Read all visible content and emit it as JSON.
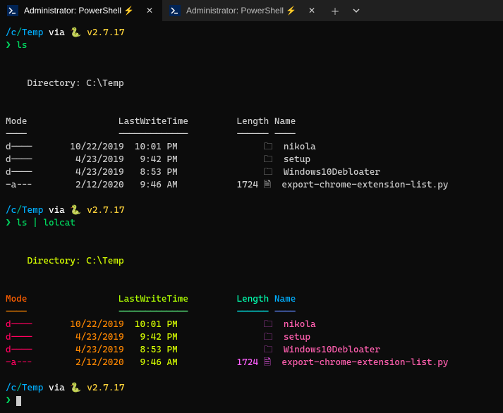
{
  "tabs": [
    {
      "title": "Administrator: PowerShell ⚡"
    },
    {
      "title": "Administrator: PowerShell ⚡"
    }
  ],
  "prompt": {
    "path_pre": "/c",
    "path_sep": "/",
    "path_post": "Temp",
    "via": " via ",
    "python_icon": "🐍",
    "python_ver": " v2.7.17",
    "arrow": "❯ "
  },
  "cmds": {
    "ls": "ls",
    "pipe": " | ",
    "lolcat": "lolcat"
  },
  "listing": {
    "dir_label": "    Directory: C:\\Temp",
    "hdr_mode": "Mode",
    "hdr_lwt": "LastWriteTime",
    "hdr_len": "Length",
    "hdr_name": "Name",
    "dash_mode": "----",
    "dash_lwt": "-------------",
    "dash_len": "------",
    "dash_name": "----",
    "rows": [
      {
        "mode": "d----",
        "date": "10/22/2019",
        "time": "10:01 PM",
        "len": "",
        "icon": "📁",
        "name": "nikola"
      },
      {
        "mode": "d----",
        "date": "4/23/2019",
        "time": " 9:42 PM",
        "len": "",
        "icon": "📁",
        "name": "setup"
      },
      {
        "mode": "d----",
        "date": "4/23/2019",
        "time": " 8:53 PM",
        "len": "",
        "icon": "📁",
        "name": "Windows10Debloater"
      },
      {
        "mode": "-a---",
        "date": "2/12/2020",
        "time": " 9:46 AM",
        "len": "1724",
        "icon": "📄",
        "name": "export-chrome-extension-list.py"
      }
    ]
  }
}
